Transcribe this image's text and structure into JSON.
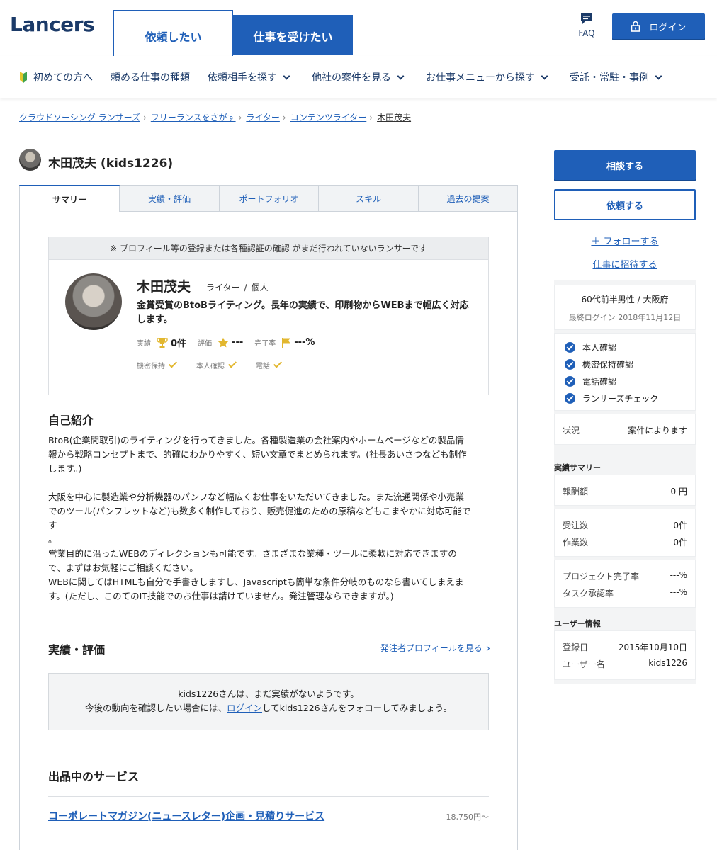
{
  "header": {
    "logo": "Lancers",
    "tab_client": "依頼したい",
    "tab_worker": "仕事を受けたい",
    "faq": "FAQ",
    "login": "ログイン"
  },
  "gnav": {
    "beginner": "初めての方へ",
    "job_types": "頼める仕事の種類",
    "find_partner": "依頼相手を探す",
    "other_projects": "他社の案件を見る",
    "work_menu": "お仕事メニューから探す",
    "cases": "受託・常駐・事例"
  },
  "breadcrumb": [
    "クラウドソーシング ランサーズ",
    "フリーランスをさがす",
    "ライター",
    "コンテンツライター",
    "木田茂夫"
  ],
  "profile": {
    "title": "木田茂夫 (kids1226)",
    "tabs": [
      "サマリー",
      "実績・評価",
      "ポートフォリオ",
      "スキル",
      "過去の提案"
    ],
    "notice": "※ プロフィール等の登録または各種認証の確認 がまだ行われていないランサーです",
    "name": "木田茂夫",
    "role": "ライター",
    "type": "個人",
    "tagline": "金賞受賞のBtoBライティング。長年の実績で、印刷物からWEBまで幅広く対応します。",
    "stats": {
      "achievements_label": "実績",
      "achievements_value": "0件",
      "rating_label": "評価",
      "rating_value": "---",
      "completion_label": "完了率",
      "completion_value": "---%"
    },
    "verifications": [
      "機密保持",
      "本人確認",
      "電話"
    ]
  },
  "intro": {
    "heading": "自己紹介",
    "body": "BtoB(企業間取引)のライティングを行ってきました。各種製造業の会社案内やホームページなどの製品情\n報から戦略コンセプトまで、的確にわかりやすく、短い文章でまとめられます。(社長あいさつなども制作\nします。)\n\n大阪を中心に製造業や分析機器のパンフなど幅広くお仕事をいただいてきました。また流通関係や小売業\nでのツール(パンフレットなど)も数多く制作しており、販売促進のための原稿などもこまやかに対応可能で\nす\n。\n営業目的に沿ったWEBのディレクションも可能です。さまざまな業種・ツールに柔軟に対応できますの\nで、まずはお気軽にご相談ください。\nWEBに関してはHTMLも自分で手書きしますし、Javascriptも簡単な条件分岐のものなら書いてしまえま\nす。(ただし、このてのIT技能でのお仕事は請けていません。発注管理ならできますが。)"
  },
  "reviews": {
    "heading": "実績・評価",
    "link": "発注者プロフィールを見る",
    "empty_line1": "kids1226さんは、まだ実績がないようです。",
    "empty_line2_pre": "今後の動向を確認したい場合には、",
    "empty_line2_link": "ログイン",
    "empty_line2_post": "してkids1226さんをフォローしてみましょう。"
  },
  "services": {
    "heading": "出品中のサービス",
    "items": [
      {
        "title": "コーポレートマガジン(ニュースレター)企画・見積りサービス",
        "price": "18,750円〜"
      }
    ]
  },
  "sidebar": {
    "consult": "相談する",
    "request": "依頼する",
    "follow": "＋ フォローする",
    "invite": "仕事に招待する",
    "age_location": "60代前半男性 / 大阪府",
    "last_login": "最終ログイン 2018年11月12日",
    "verifications": [
      "本人確認",
      "機密保持確認",
      "電話確認",
      "ランサーズチェック"
    ],
    "status_label": "状況",
    "status_value": "案件によります",
    "summary_heading": "実績サマリー",
    "reward_label": "報酬額",
    "reward_value": "0 円",
    "orders_label": "受注数",
    "orders_value": "0件",
    "tasks_label": "作業数",
    "tasks_value": "0件",
    "project_rate_label": "プロジェクト完了率",
    "project_rate_value": "---%",
    "task_rate_label": "タスク承認率",
    "task_rate_value": "---%",
    "user_heading": "ユーザー情報",
    "registered_label": "登録日",
    "registered_value": "2015年10月10日",
    "username_label": "ユーザー名",
    "username_value": "kids1226"
  },
  "colors": {
    "brand": "#1f5fb8",
    "logo": "#1b3a68",
    "check": "#e2b72f"
  }
}
